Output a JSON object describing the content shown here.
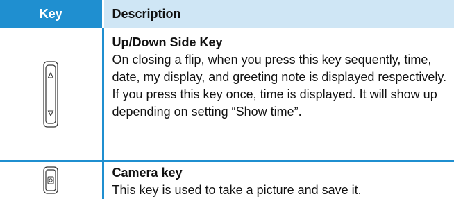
{
  "table": {
    "header": {
      "key": "Key",
      "description": "Description"
    },
    "rows": [
      {
        "icon": "up-down-side-key-icon",
        "title": "Up/Down Side Key",
        "text": "On closing a flip, when you press this key sequently, time, date, my display, and greeting note is displayed respectively. If you press this key once, time is displayed. It will show up depending on setting “Show time”."
      },
      {
        "icon": "camera-key-icon",
        "title": "Camera key",
        "text": "This key is used to take a picture and save it."
      }
    ]
  },
  "colors": {
    "header_key_bg": "#1f8fd0",
    "header_desc_bg": "#cfe6f5",
    "divider": "#1f8fd0"
  }
}
